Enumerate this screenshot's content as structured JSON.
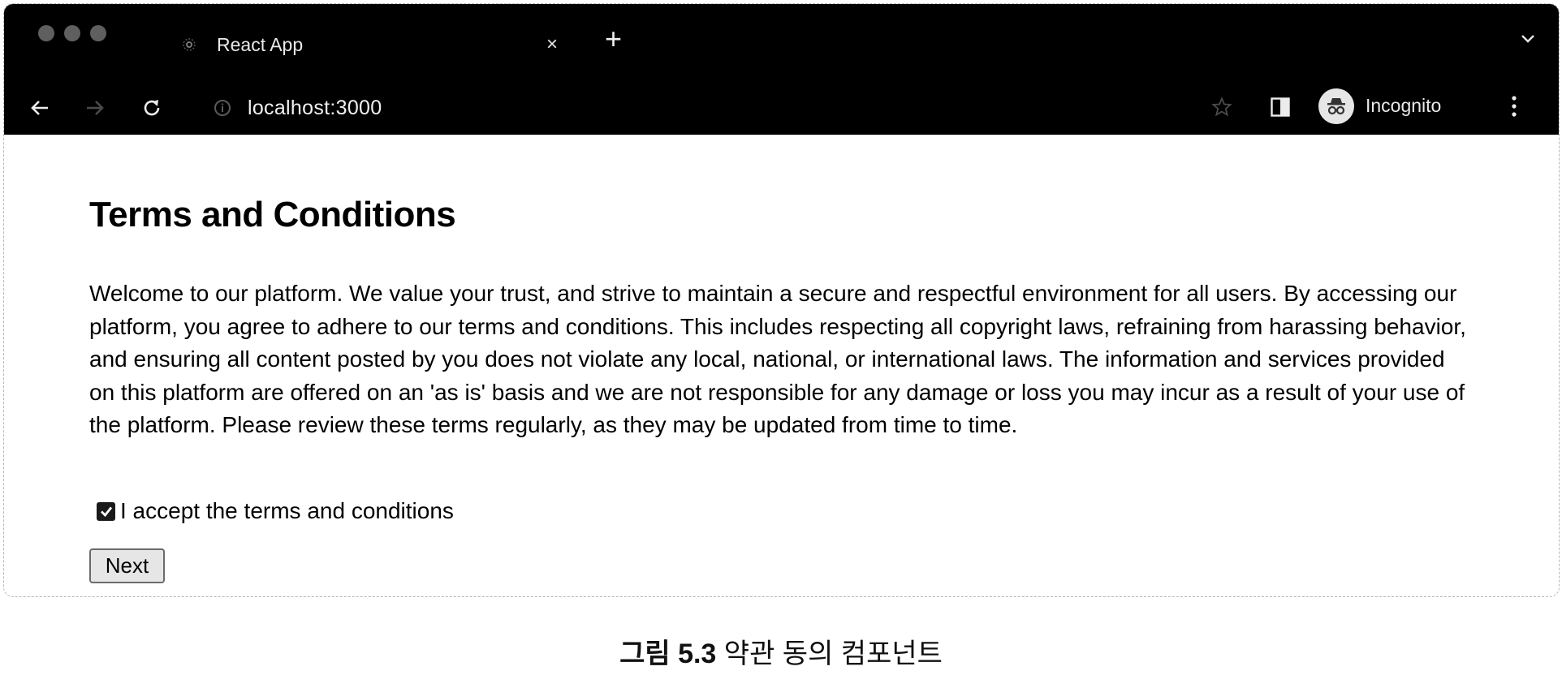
{
  "tab": {
    "title": "React App",
    "close_symbol": "×",
    "new_tab_symbol": "+"
  },
  "address_bar": {
    "url": "localhost:3000"
  },
  "profile": {
    "label": "Incognito"
  },
  "page": {
    "title": "Terms and Conditions",
    "body": "Welcome to our platform. We value your trust, and strive to maintain a secure and respectful environment for all users. By accessing our platform, you agree to adhere to our terms and conditions. This includes respecting all copyright laws, refraining from harassing behavior, and ensuring all content posted by you does not violate any local, national, or international laws. The information and services provided on this platform are offered on an 'as is' basis and we are not responsible for any damage or loss you may incur as a result of your use of the platform. Please review these terms regularly, as they may be updated from time to time.",
    "checkbox_label": "I accept the terms and conditions",
    "checkbox_checked": true,
    "next_button": "Next"
  },
  "caption": {
    "number": "그림 5.3",
    "text": "약관 동의 컴포넌트"
  },
  "icons": [
    "tab-favicon-icon",
    "close-icon",
    "plus-icon",
    "chevron-down-icon",
    "back-arrow-icon",
    "forward-arrow-icon",
    "reload-icon",
    "info-icon",
    "star-icon",
    "side-panel-icon",
    "incognito-icon",
    "more-vert-icon",
    "checkmark-icon"
  ],
  "colors": {
    "chrome_bg": "#000000",
    "button_bg": "#e6e6e6",
    "page_bg": "#ffffff"
  }
}
